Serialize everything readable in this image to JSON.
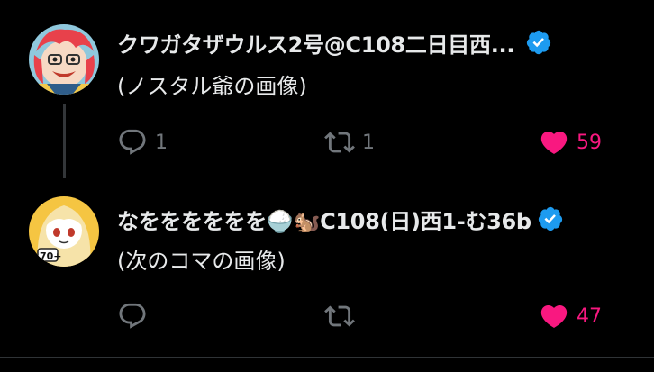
{
  "colors": {
    "background": "#000000",
    "text": "#e7e9ea",
    "muted": "#71767b",
    "like": "#f91880",
    "verified": "#1d9bf0",
    "thread_line": "#333639"
  },
  "posts": [
    {
      "display_name": "クワガタザウルス2号@C108二日目西...",
      "verified": true,
      "text": "(ノスタル爺の画像)",
      "reply_count": "1",
      "retweet_count": "1",
      "like_count": "59",
      "liked": true
    },
    {
      "display_name": "なをををををを🍚🐿️C108(日)西1-む36b",
      "verified": true,
      "text": "(次のコマの画像)",
      "reply_count": "",
      "retweet_count": "",
      "like_count": "47",
      "liked": true
    }
  ],
  "icons": {
    "reply": "reply-icon",
    "retweet": "retweet-icon",
    "like": "heart-icon",
    "verified": "verified-badge-icon"
  }
}
